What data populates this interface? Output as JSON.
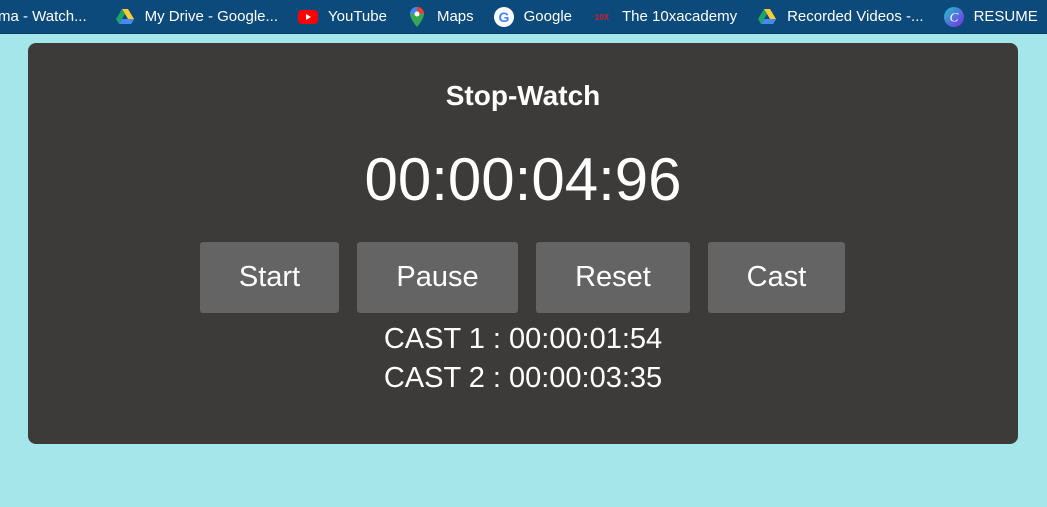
{
  "bookmarks": [
    {
      "label": "ma - Watch...",
      "icon": "page-icon"
    },
    {
      "label": "My Drive - Google...",
      "icon": "google-drive-icon"
    },
    {
      "label": "YouTube",
      "icon": "youtube-icon"
    },
    {
      "label": "Maps",
      "icon": "google-maps-icon"
    },
    {
      "label": "Google",
      "icon": "google-icon"
    },
    {
      "label": "The 10xacademy",
      "icon": "10x-icon"
    },
    {
      "label": "Recorded Videos -...",
      "icon": "google-drive-icon"
    },
    {
      "label": "RESUME",
      "icon": "canva-icon"
    }
  ],
  "stopwatch": {
    "title": "Stop-Watch",
    "time": "00:00:04:96",
    "buttons": {
      "start": "Start",
      "pause": "Pause",
      "reset": "Reset",
      "cast": "Cast"
    },
    "casts": [
      "CAST 1 : 00:00:01:54",
      "CAST 2 : 00:00:03:35"
    ]
  },
  "colors": {
    "page_bg": "#a4e6ea",
    "bookmarks_bg": "#0b4a7a",
    "card_bg": "#3d3b3a",
    "button_bg": "#646464",
    "text": "#ffffff"
  }
}
